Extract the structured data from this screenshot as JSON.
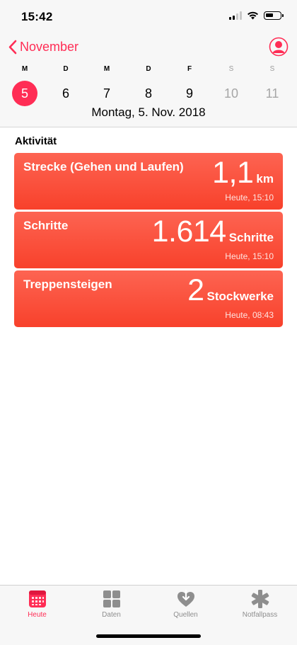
{
  "status_bar": {
    "time": "15:42"
  },
  "header": {
    "back_label": "November",
    "weekdays": [
      {
        "label": "M",
        "weekend": false
      },
      {
        "label": "D",
        "weekend": false
      },
      {
        "label": "M",
        "weekend": false
      },
      {
        "label": "D",
        "weekend": false
      },
      {
        "label": "F",
        "weekend": false
      },
      {
        "label": "S",
        "weekend": true
      },
      {
        "label": "S",
        "weekend": true
      }
    ],
    "days": [
      {
        "label": "5",
        "selected": true,
        "weekend": false
      },
      {
        "label": "6",
        "selected": false,
        "weekend": false
      },
      {
        "label": "7",
        "selected": false,
        "weekend": false
      },
      {
        "label": "8",
        "selected": false,
        "weekend": false
      },
      {
        "label": "9",
        "selected": false,
        "weekend": false
      },
      {
        "label": "10",
        "selected": false,
        "weekend": true
      },
      {
        "label": "11",
        "selected": false,
        "weekend": true
      }
    ],
    "date_line": "Montag, 5. Nov. 2018"
  },
  "activity": {
    "section_title": "Aktivität",
    "cards": [
      {
        "name": "Strecke (Gehen und Laufen)",
        "value": "1,1",
        "unit": "km",
        "stamp": "Heute, 15:10"
      },
      {
        "name": "Schritte",
        "value": "1.614",
        "unit": "Schritte",
        "stamp": "Heute, 15:10"
      },
      {
        "name": "Treppensteigen",
        "value": "2",
        "unit": "Stockwerke",
        "stamp": "Heute, 08:43"
      }
    ]
  },
  "tabbar": {
    "tabs": [
      {
        "label": "Heute",
        "icon": "calendar-grid-icon",
        "active": true
      },
      {
        "label": "Daten",
        "icon": "four-squares-icon",
        "active": false
      },
      {
        "label": "Quellen",
        "icon": "heart-download-icon",
        "active": false
      },
      {
        "label": "Notfallpass",
        "icon": "medical-asterisk-icon",
        "active": false
      }
    ]
  },
  "colors": {
    "accent": "#ff2d55",
    "card": "#fb5440",
    "tab_inactive": "#8e8e8e"
  }
}
